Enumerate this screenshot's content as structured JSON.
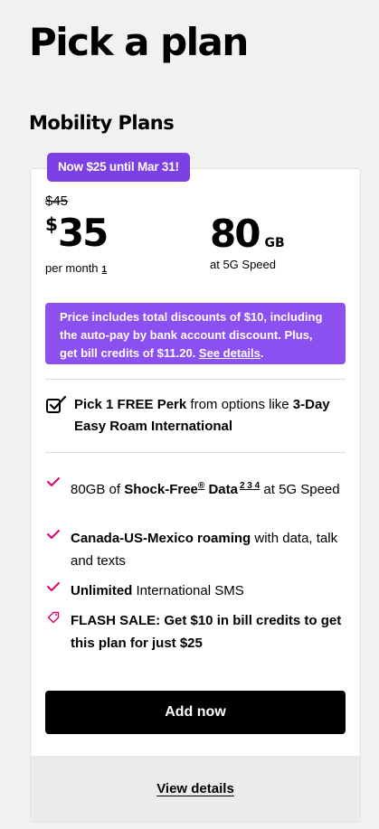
{
  "page": {
    "title": "Pick a plan"
  },
  "section": {
    "title": "Mobility Plans"
  },
  "plan": {
    "promo_tag": "Now $25 until Mar 31!",
    "old_price": "$45",
    "currency": "$",
    "price": "35",
    "per_month": "per month",
    "per_month_footnote": "1",
    "data_amount": "80",
    "data_unit": "GB",
    "data_speed": "at 5G Speed",
    "discount": {
      "text": "Price includes total discounts of $10, including the auto-pay by bank account discount. Plus, get bill credits of $11.20.",
      "link": "See details",
      "end": "."
    },
    "perk": {
      "bold_lead": "Pick 1 FREE Perk",
      "middle": " from options like ",
      "bold_tail": "3-Day Easy Roam International"
    },
    "features": [
      {
        "bold1": "",
        "pre": "80GB of ",
        "bold": "Shock-Free",
        "reg": "®",
        "after": " Data",
        "footnotes": "2 3 4",
        "end": " at 5G Speed"
      },
      {
        "bold": "Canada-US-Mexico roaming",
        "rest": " with data, talk and texts"
      },
      {
        "bold": "Unlimited",
        "rest": " International SMS"
      },
      {
        "bold": "FLASH SALE: Get $10 in bill credits to get this plan for just $25",
        "rest": ""
      }
    ],
    "add_button": "Add now",
    "view_details": "View details"
  },
  "colors": {
    "accent_purple": "#7b3fe4",
    "discount_purple": "#8c4ff0",
    "check_pink": "#e0006c",
    "background": "#f2f1f2"
  },
  "icons": {
    "perk": "checkbox-check-icon",
    "feature": "check-mark-icon",
    "sale": "price-tag-icon"
  }
}
